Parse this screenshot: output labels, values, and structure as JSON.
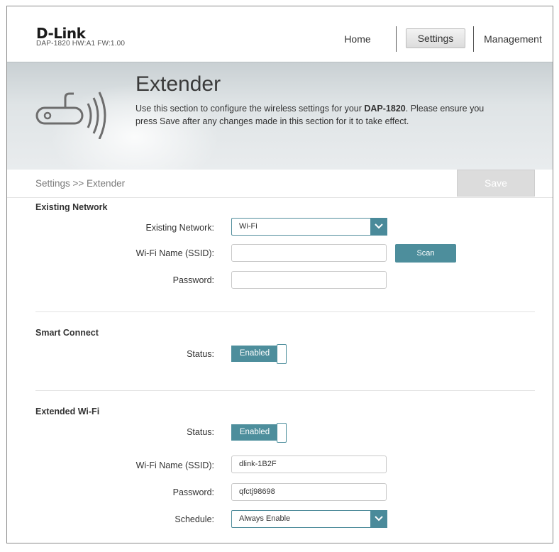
{
  "header": {
    "logo": "D-Link",
    "model_info": "DAP-1820  HW:A1  FW:1.00",
    "nav": {
      "home": "Home",
      "settings": "Settings",
      "management": "Management"
    }
  },
  "banner": {
    "title": "Extender",
    "description_a": "Use this section to configure the wireless settings for your ",
    "description_model": "DAP-1820",
    "description_b": ". Please ensure you press Save after any changes made in this section for it to take effect.",
    "icon": "router-wifi-icon"
  },
  "breadcrumb": "Settings >> Extender",
  "save_label": "Save",
  "existing_network": {
    "section_title": "Existing Network",
    "network_label": "Existing Network:",
    "network_value": "Wi-Fi",
    "ssid_label": "Wi-Fi Name (SSID):",
    "ssid_value": "",
    "scan_label": "Scan",
    "password_label": "Password:",
    "password_value": ""
  },
  "smart_connect": {
    "section_title": "Smart Connect",
    "status_label": "Status:",
    "status_value": "Enabled"
  },
  "extended_wifi": {
    "section_title": "Extended Wi-Fi",
    "status_label": "Status:",
    "status_value": "Enabled",
    "ssid_label": "Wi-Fi Name (SSID):",
    "ssid_value": "dlink-1B2F",
    "password_label": "Password:",
    "password_value": "qfctj98698",
    "schedule_label": "Schedule:",
    "schedule_value": "Always Enable"
  },
  "colors": {
    "accent": "#4d8e9c",
    "save_disabled": "#dcdcdc"
  }
}
